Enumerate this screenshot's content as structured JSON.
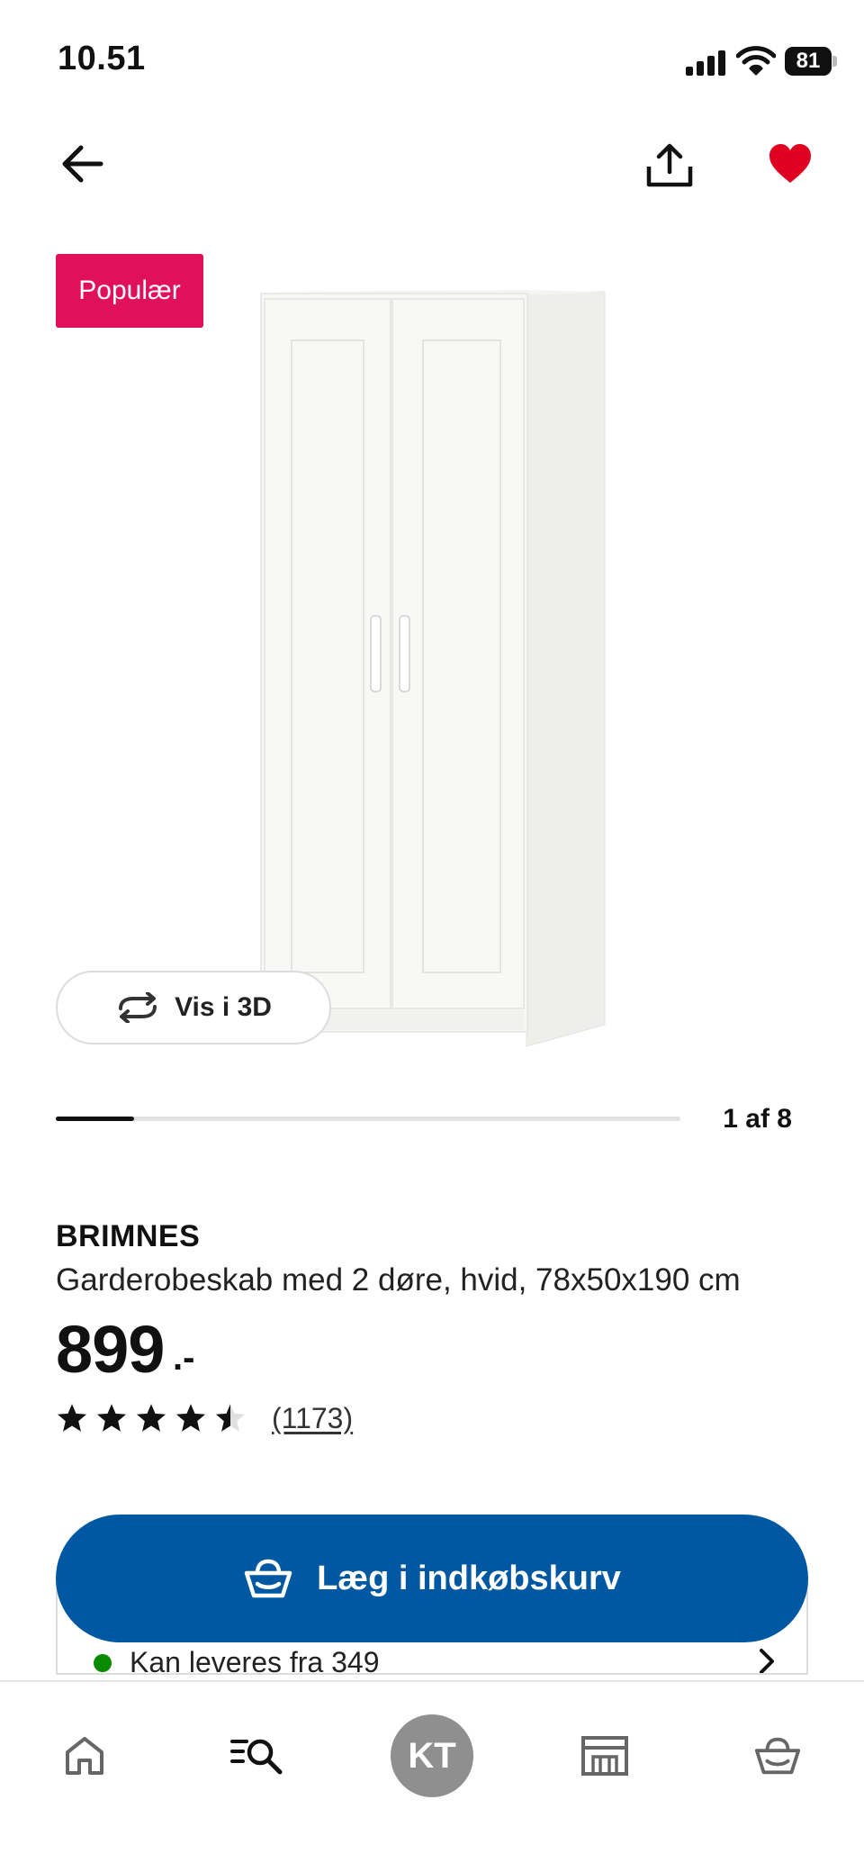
{
  "status_bar": {
    "time": "10.51",
    "battery": "81"
  },
  "nav": {
    "back_icon": "arrow-left-icon",
    "share_icon": "share-icon",
    "favorite_icon": "heart-filled-icon"
  },
  "media": {
    "badge": "Populær",
    "view3d_label": "Vis i 3D",
    "slide_counter": "1 af 8",
    "progress_fraction": 0.125
  },
  "product": {
    "name": "BRIMNES",
    "description": "Garderobeskab med 2 døre, hvid, 78x50x190 cm",
    "price": "899",
    "price_suffix": ".-",
    "rating": 4.5,
    "review_count": "(1173)"
  },
  "cta": {
    "add_to_cart_label": "Læg i indkøbskurv"
  },
  "delivery": {
    "text": "Kan leveres fra 349"
  },
  "tabbar": {
    "items": [
      "home-icon",
      "search-list-icon",
      "profile-avatar",
      "store-icon",
      "basket-icon"
    ],
    "avatar_initials": "KT"
  },
  "colors": {
    "badge": "#e0105a",
    "primary_button": "#0058a3",
    "heart": "#e00021",
    "in_stock": "#0a8a00"
  }
}
